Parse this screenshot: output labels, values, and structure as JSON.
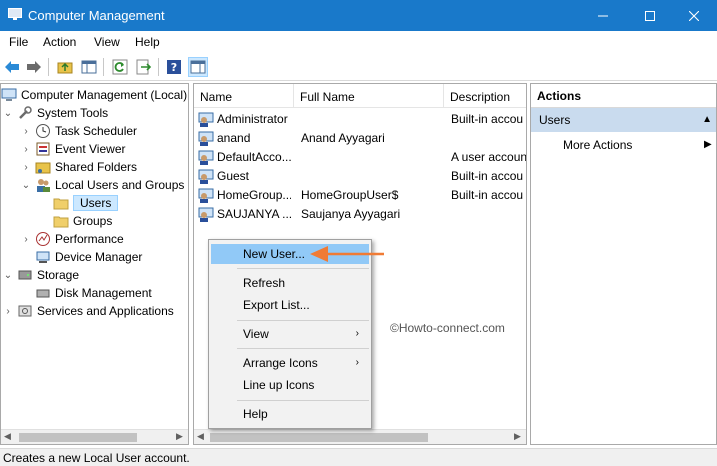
{
  "window": {
    "title": "Computer Management"
  },
  "menu": [
    "File",
    "Action",
    "View",
    "Help"
  ],
  "tree": [
    {
      "label": "Computer Management (Local)",
      "icon": "computer-icon"
    },
    {
      "label": "System Tools",
      "icon": "tools-icon"
    },
    {
      "label": "Task Scheduler",
      "icon": "clock-icon"
    },
    {
      "label": "Event Viewer",
      "icon": "event-viewer-icon"
    },
    {
      "label": "Shared Folders",
      "icon": "shared-folder-icon"
    },
    {
      "label": "Local Users and Groups",
      "icon": "users-group-icon"
    },
    {
      "label": "Users",
      "icon": "folder-icon"
    },
    {
      "label": "Groups",
      "icon": "folder-icon"
    },
    {
      "label": "Performance",
      "icon": "performance-icon"
    },
    {
      "label": "Device Manager",
      "icon": "device-manager-icon"
    },
    {
      "label": "Storage",
      "icon": "storage-icon"
    },
    {
      "label": "Disk Management",
      "icon": "disk-icon"
    },
    {
      "label": "Services and Applications",
      "icon": "services-icon"
    }
  ],
  "list": {
    "columns": [
      "Name",
      "Full Name",
      "Description"
    ],
    "rows": [
      {
        "name": "Administrator",
        "full_name": "",
        "description": "Built-in accou"
      },
      {
        "name": "anand",
        "full_name": "Anand Ayyagari",
        "description": ""
      },
      {
        "name": "DefaultAcco...",
        "full_name": "",
        "description": "A user accoun"
      },
      {
        "name": "Guest",
        "full_name": "",
        "description": "Built-in accou"
      },
      {
        "name": "HomeGroup...",
        "full_name": "HomeGroupUser$",
        "description": "Built-in accou"
      },
      {
        "name": "SAUJANYA ...",
        "full_name": "Saujanya Ayyagari",
        "description": ""
      }
    ]
  },
  "actions": {
    "header": "Actions",
    "section": "Users",
    "more": "More Actions"
  },
  "context_menu": {
    "new_user": "New User...",
    "refresh": "Refresh",
    "export": "Export List...",
    "view": "View",
    "arrange": "Arrange Icons",
    "lineup": "Line up Icons",
    "help": "Help"
  },
  "watermark": "©Howto-connect.com",
  "status": "Creates a new Local User account.",
  "colors": {
    "titlebar": "#1979ca",
    "highlight": "#91c9f7",
    "arrow": "#f07b35"
  }
}
